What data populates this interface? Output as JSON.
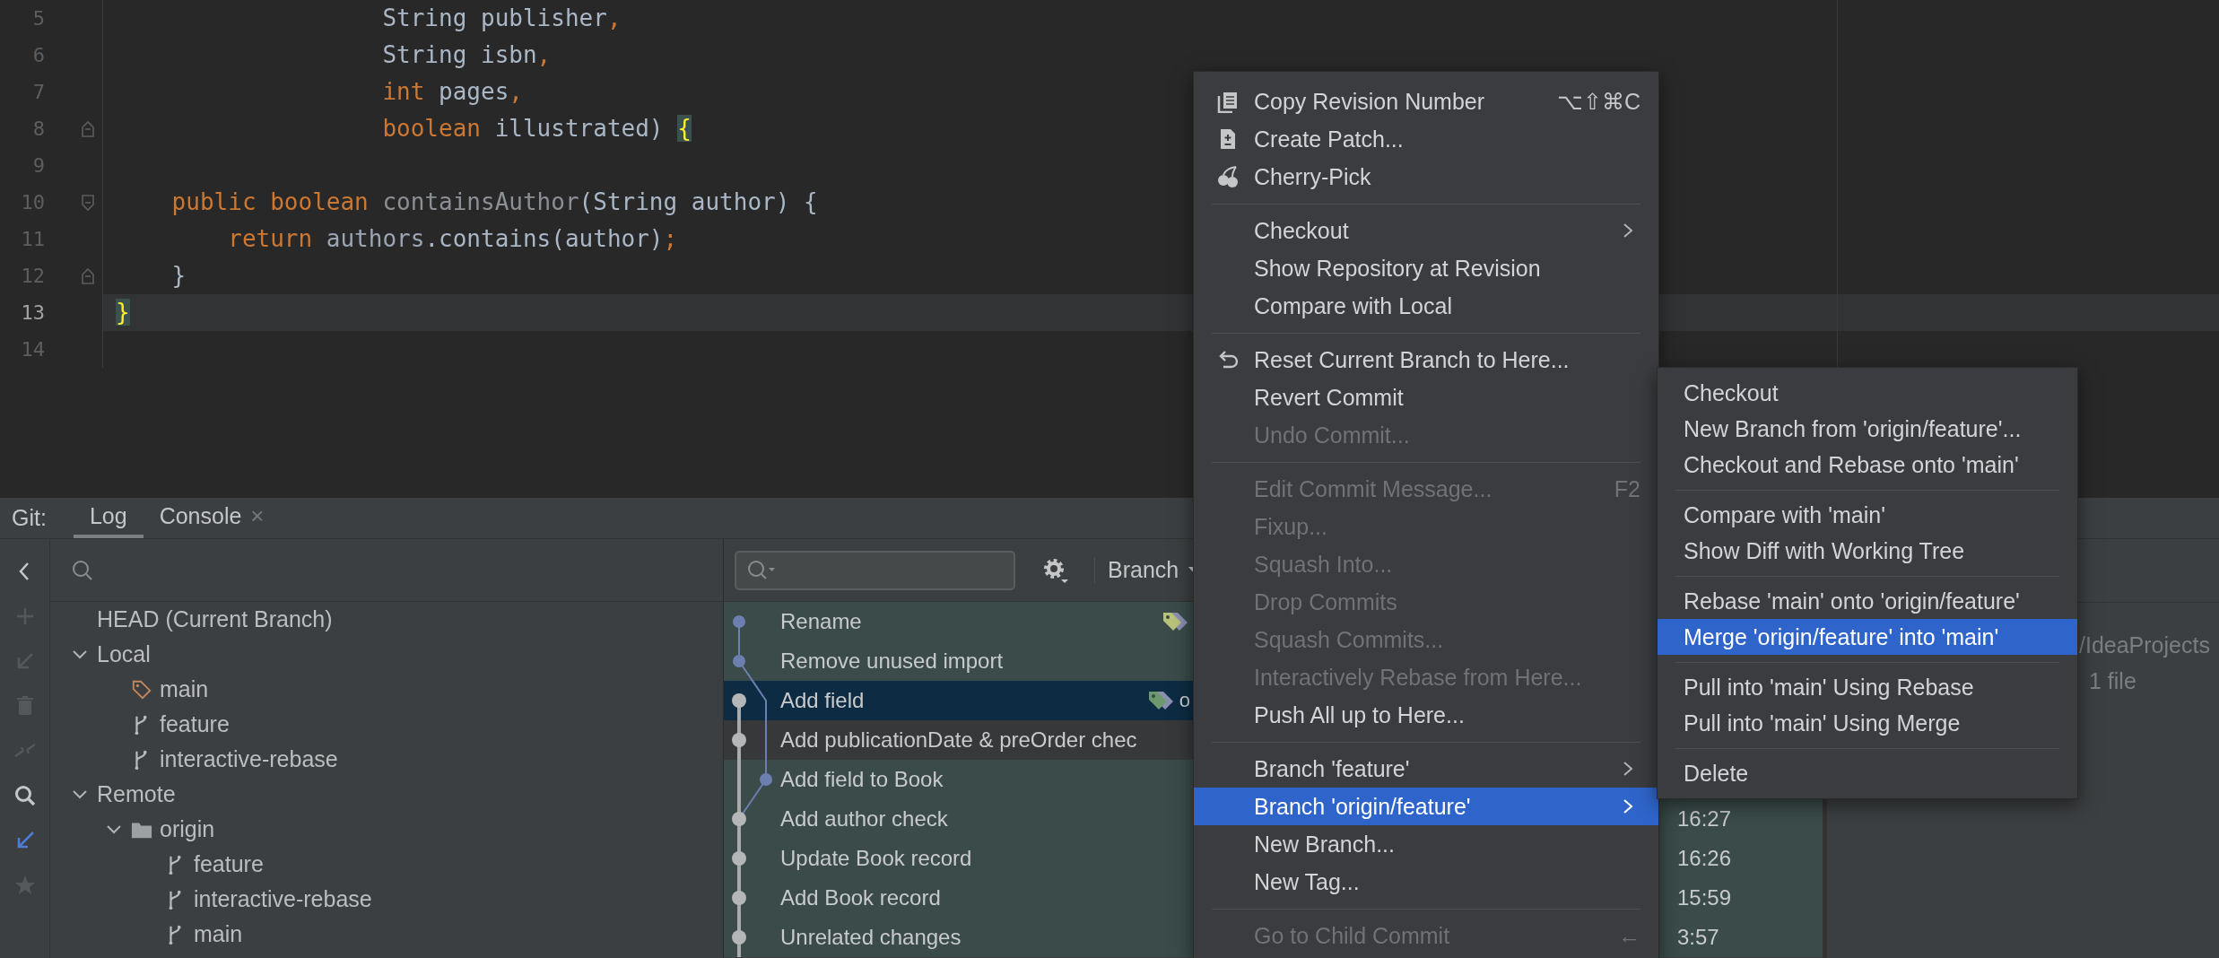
{
  "editor": {
    "lines": [
      {
        "number": "5",
        "current": false,
        "kind": "plain",
        "tokens": [
          {
            "text": "                   String publisher",
            "kind": "plain"
          },
          {
            "text": ",",
            "kind": "punct"
          }
        ]
      },
      {
        "number": "6",
        "current": false,
        "kind": "plain",
        "tokens": [
          {
            "text": "                   String isbn",
            "kind": "plain"
          },
          {
            "text": ",",
            "kind": "punct"
          }
        ]
      },
      {
        "number": "7",
        "current": false,
        "kind": "plain",
        "tokens": [
          {
            "text": "                   int",
            "kind": "keyword"
          },
          {
            "text": " pages",
            "kind": "plain"
          },
          {
            "text": ",",
            "kind": "punct"
          }
        ]
      },
      {
        "number": "8",
        "current": false,
        "kind": "fold_end",
        "tokens": [
          {
            "text": "                   boolean",
            "kind": "keyword"
          },
          {
            "text": " illustrated) ",
            "kind": "plain"
          },
          {
            "text": "{",
            "kind": "brace_match"
          }
        ]
      },
      {
        "number": "9",
        "current": false,
        "kind": "plain"
      },
      {
        "number": "10",
        "current": false,
        "kind": "fold_start",
        "tokens": [
          {
            "text": "    public boolean",
            "kind": "keyword"
          },
          {
            "text": " containsAuthor",
            "kind": "unused"
          },
          {
            "text": "(String author) {",
            "kind": "plain"
          }
        ]
      },
      {
        "number": "11",
        "current": false,
        "kind": "plain",
        "tokens": [
          {
            "text": "        return",
            "kind": "keyword"
          },
          {
            "text": " authors",
            "kind": "field"
          },
          {
            "text": ".contains(author)",
            "kind": "plain"
          },
          {
            "text": ";",
            "kind": "punct"
          }
        ]
      },
      {
        "number": "12",
        "current": false,
        "kind": "fold_end",
        "tokens": [
          {
            "text": "    }",
            "kind": "plain"
          }
        ]
      },
      {
        "number": "13",
        "current": true,
        "kind": "plain",
        "tokens": [
          {
            "text": "}",
            "kind": "brace_match"
          }
        ]
      },
      {
        "number": "14",
        "current": false,
        "kind": "plain"
      }
    ]
  },
  "tool_window": {
    "title": "Git:",
    "tabs": [
      {
        "label": "Log",
        "selected": true
      },
      {
        "label": "Console",
        "selected": false,
        "close": "×"
      }
    ]
  },
  "toolbar": [
    {
      "kind": "back",
      "disabled": false
    },
    {
      "kind": "add",
      "disabled": true
    },
    {
      "kind": "update",
      "disabled": true
    },
    {
      "kind": "delete",
      "disabled": true
    },
    {
      "kind": "merge",
      "disabled": true
    },
    {
      "kind": "search",
      "disabled": false
    },
    {
      "kind": "fetch",
      "disabled": false
    },
    {
      "kind": "favorite",
      "disabled": true
    }
  ],
  "branches": {
    "tree": [
      {
        "label": "HEAD (Current Branch)",
        "kind": "head"
      },
      {
        "label": "Local",
        "kind": "group",
        "expanded": true,
        "children": [
          {
            "label": "main",
            "kind": "current"
          },
          {
            "label": "feature",
            "kind": "branch"
          },
          {
            "label": "interactive-rebase",
            "kind": "branch"
          }
        ]
      },
      {
        "label": "Remote",
        "kind": "group",
        "expanded": true,
        "children": [
          {
            "label": "origin",
            "kind": "folder",
            "expanded": true,
            "children": [
              {
                "label": "feature",
                "kind": "branch"
              },
              {
                "label": "interactive-rebase",
                "kind": "branch"
              },
              {
                "label": "main",
                "kind": "branch"
              }
            ]
          }
        ]
      }
    ]
  },
  "log": {
    "filter": "Branch",
    "commits": [
      {
        "subject": "Rename",
        "kind": "side",
        "selected": false,
        "highlighted": true,
        "ref_marker": true
      },
      {
        "subject": "Remove unused import",
        "kind": "side",
        "selected": false,
        "highlighted": true,
        "ref_marker": false
      },
      {
        "subject": "Add field",
        "kind": "main",
        "selected": true,
        "highlighted": true,
        "ref_marker": true,
        "ref_label": "o"
      },
      {
        "subject": "Add publicationDate & preOrder chec",
        "kind": "main",
        "selected": false,
        "highlighted": false,
        "ref_marker": false
      },
      {
        "subject": "Add field to Book",
        "kind": "side",
        "selected": false,
        "highlighted": true,
        "ref_marker": false
      },
      {
        "subject": "Add author check",
        "kind": "main",
        "selected": false,
        "highlighted": true,
        "ref_marker": false,
        "time": "16:27"
      },
      {
        "subject": "Update Book record",
        "kind": "main",
        "selected": false,
        "highlighted": true,
        "ref_marker": false,
        "time": "16:26"
      },
      {
        "subject": "Add Book record",
        "kind": "main",
        "selected": false,
        "highlighted": true,
        "ref_marker": false,
        "time": "15:59"
      },
      {
        "subject": "Unrelated changes",
        "kind": "main",
        "selected": false,
        "highlighted": true,
        "ref_marker": false,
        "time": "3:57"
      }
    ]
  },
  "details": {
    "path": "/IdeaProjects",
    "files": "1 file"
  },
  "context_menu": {
    "groups": [
      {
        "items": [
          {
            "label": "Copy Revision Number",
            "kind": "copy",
            "shortcut": "⌥⇧⌘C",
            "disabled": false,
            "submenu": false,
            "selected": false
          },
          {
            "label": "Create Patch...",
            "kind": "patch",
            "disabled": false,
            "submenu": false,
            "selected": false
          },
          {
            "label": "Cherry-Pick",
            "kind": "cherry",
            "disabled": false,
            "submenu": false,
            "selected": false
          }
        ]
      },
      {
        "items": [
          {
            "label": "Checkout",
            "kind": "plain",
            "disabled": false,
            "submenu": true,
            "selected": false
          },
          {
            "label": "Show Repository at Revision",
            "kind": "plain",
            "disabled": false,
            "submenu": false,
            "selected": false
          },
          {
            "label": "Compare with Local",
            "kind": "plain",
            "disabled": false,
            "submenu": false,
            "selected": false
          }
        ]
      },
      {
        "items": [
          {
            "label": "Reset Current Branch to Here...",
            "kind": "reset",
            "disabled": false,
            "submenu": false,
            "selected": false
          },
          {
            "label": "Revert Commit",
            "kind": "plain",
            "disabled": false,
            "submenu": false,
            "selected": false
          },
          {
            "label": "Undo Commit...",
            "kind": "plain",
            "disabled": true,
            "submenu": false,
            "selected": false
          }
        ]
      },
      {
        "items": [
          {
            "label": "Edit Commit Message...",
            "kind": "plain",
            "shortcut": "F2",
            "disabled": true,
            "submenu": false,
            "selected": false
          },
          {
            "label": "Fixup...",
            "kind": "plain",
            "disabled": true,
            "submenu": false,
            "selected": false
          },
          {
            "label": "Squash Into...",
            "kind": "plain",
            "disabled": true,
            "submenu": false,
            "selected": false
          },
          {
            "label": "Drop Commits",
            "kind": "plain",
            "disabled": true,
            "submenu": false,
            "selected": false
          },
          {
            "label": "Squash Commits...",
            "kind": "plain",
            "disabled": true,
            "submenu": false,
            "selected": false
          },
          {
            "label": "Interactively Rebase from Here...",
            "kind": "plain",
            "disabled": true,
            "submenu": false,
            "selected": false
          },
          {
            "label": "Push All up to Here...",
            "kind": "plain",
            "disabled": false,
            "submenu": false,
            "selected": false
          }
        ]
      },
      {
        "items": [
          {
            "label": "Branch 'feature'",
            "kind": "plain",
            "disabled": false,
            "submenu": true,
            "selected": false
          },
          {
            "label": "Branch 'origin/feature'",
            "kind": "plain",
            "disabled": false,
            "submenu": true,
            "selected": true
          },
          {
            "label": "New Branch...",
            "kind": "plain",
            "disabled": false,
            "submenu": false,
            "selected": false
          },
          {
            "label": "New Tag...",
            "kind": "plain",
            "disabled": false,
            "submenu": false,
            "selected": false
          }
        ]
      },
      {
        "items": [
          {
            "label": "Go to Child Commit",
            "kind": "plain",
            "shortcut": "←",
            "disabled": true,
            "submenu": false,
            "selected": false
          }
        ]
      }
    ]
  },
  "submenu": {
    "groups": [
      {
        "items": [
          {
            "label": "Checkout",
            "selected": false
          },
          {
            "label": "New Branch from 'origin/feature'...",
            "selected": false
          },
          {
            "label": "Checkout and Rebase onto 'main'",
            "selected": false
          }
        ]
      },
      {
        "items": [
          {
            "label": "Compare with 'main'",
            "selected": false
          },
          {
            "label": "Show Diff with Working Tree",
            "selected": false
          }
        ]
      },
      {
        "items": [
          {
            "label": "Rebase 'main' onto 'origin/feature'",
            "selected": false
          },
          {
            "label": "Merge 'origin/feature' into 'main'",
            "selected": true
          }
        ]
      },
      {
        "items": [
          {
            "label": "Pull into 'main' Using Rebase",
            "selected": false
          },
          {
            "label": "Pull into 'main' Using Merge",
            "selected": false
          }
        ]
      },
      {
        "items": [
          {
            "label": "Delete",
            "selected": false
          }
        ]
      }
    ]
  }
}
